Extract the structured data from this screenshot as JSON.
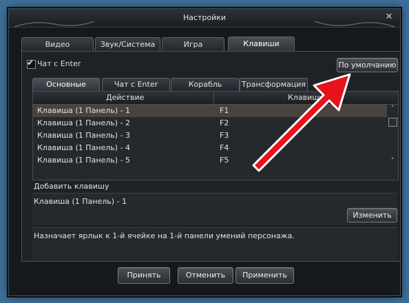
{
  "window": {
    "title": "Настройки"
  },
  "top_tabs": [
    {
      "label": "Видео"
    },
    {
      "label": "Звук/Система"
    },
    {
      "label": "Игра"
    },
    {
      "label": "Клавиши",
      "active": true
    }
  ],
  "options": {
    "chat_enter_label": "Чат с Enter",
    "chat_enter_checked": true,
    "default_button": "По умолчанию"
  },
  "sub_tabs": [
    {
      "label": "Основные",
      "active": true
    },
    {
      "label": "Чат с Enter"
    },
    {
      "label": "Корабль"
    },
    {
      "label": "Трансформация"
    }
  ],
  "table": {
    "col_action": "Действие",
    "col_keys": "Клавиши",
    "rows": [
      {
        "action": "Клавиша (1 Панель) - 1",
        "key": "F1"
      },
      {
        "action": "Клавиша (1 Панель) - 2",
        "key": "F2"
      },
      {
        "action": "Клавиша (1 Панель) - 3",
        "key": "F3"
      },
      {
        "action": "Клавиша (1 Панель) - 4",
        "key": "F4"
      },
      {
        "action": "Клавиша (1 Панель) - 5",
        "key": "F5"
      }
    ]
  },
  "add_key_label": "Добавить клавишу",
  "current_key": "Клавиша (1 Панель) - 1",
  "change_button": "Изменить",
  "description": "Назначает ярлык к 1-й ячейке на 1-й панели умений персонажа.",
  "footer": {
    "accept": "Принять",
    "cancel": "Отменить",
    "apply": "Применить"
  },
  "colors": {
    "background": "#3e6f99",
    "window": "#15191d",
    "selected_row": "#4b433b",
    "arrow": "#e8121b"
  }
}
